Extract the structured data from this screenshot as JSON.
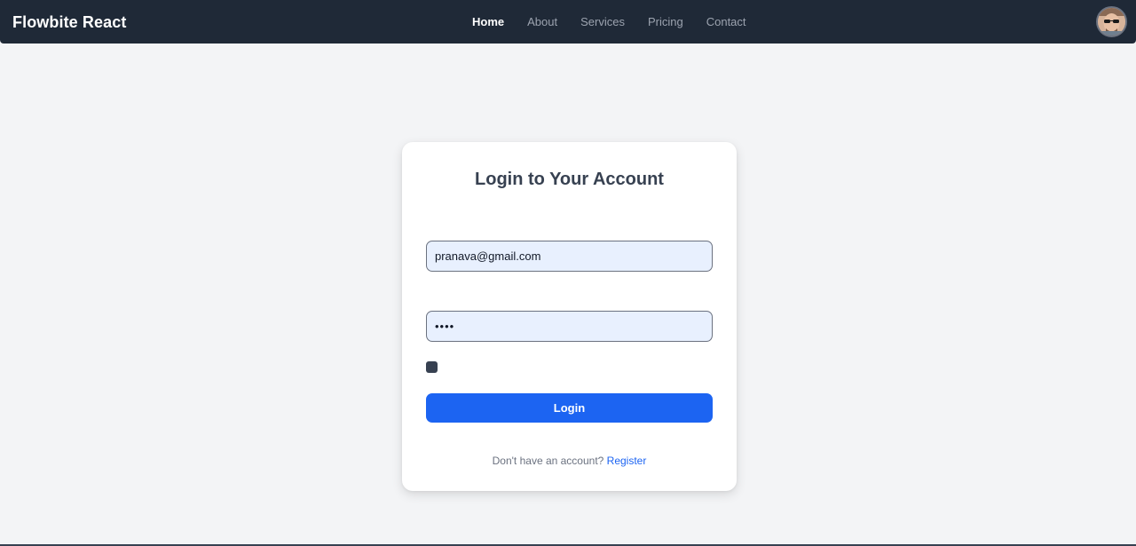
{
  "navbar": {
    "brand": "Flowbite React",
    "links": [
      {
        "label": "Home",
        "active": true
      },
      {
        "label": "About",
        "active": false
      },
      {
        "label": "Services",
        "active": false
      },
      {
        "label": "Pricing",
        "active": false
      },
      {
        "label": "Contact",
        "active": false
      }
    ],
    "avatar_icon": "user-avatar-icon"
  },
  "login": {
    "title": "Login to Your Account",
    "email_value": "pranava@gmail.com",
    "password_value": "pass",
    "remember_checked": true,
    "button_label": "Login",
    "register_prompt": "Don't have an account?",
    "register_link": "Register"
  },
  "colors": {
    "navbar_bg": "#1f2937",
    "page_bg": "#f3f4f6",
    "primary": "#1c64f2",
    "input_bg": "#e8f0fe"
  }
}
